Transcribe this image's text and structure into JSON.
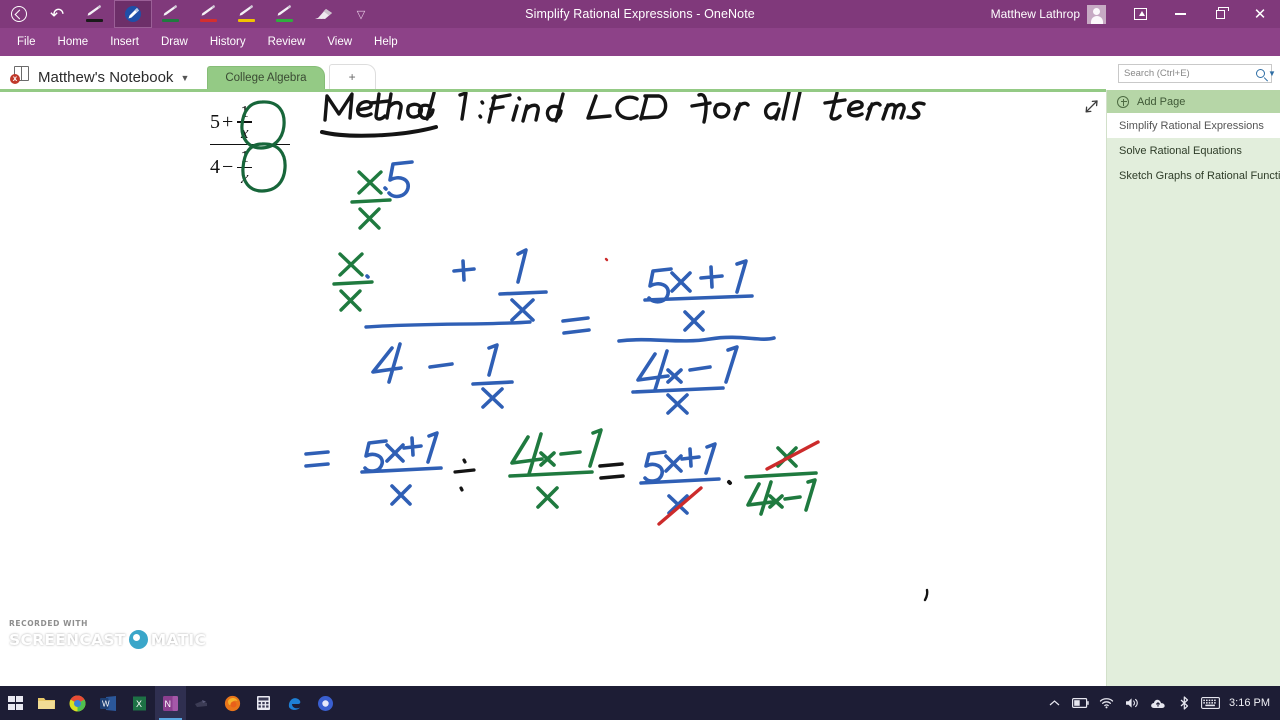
{
  "titlebar": {
    "title": "Simplify Rational Expressions  -  OneNote",
    "user": "Matthew Lathrop",
    "tools": [
      {
        "name": "back-button",
        "icon": "back-circle-icon"
      },
      {
        "name": "undo-button",
        "icon": "undo-icon"
      },
      {
        "name": "pen-black",
        "icon": "pen-icon",
        "color": "#1a1a1a",
        "selected": false
      },
      {
        "name": "pen-blue-selected",
        "icon": "pen-icon",
        "color": "#2f5fb5",
        "selected": true
      },
      {
        "name": "pen-green",
        "icon": "pen-icon",
        "color": "#1f7a3f",
        "selected": false
      },
      {
        "name": "pen-red",
        "icon": "pen-icon",
        "color": "#d32f2f",
        "selected": false
      },
      {
        "name": "pen-yellow",
        "icon": "pen-icon",
        "color": "#f2c200",
        "selected": false
      },
      {
        "name": "pen-brightgreen",
        "icon": "pen-icon",
        "color": "#2fae3e",
        "selected": false
      },
      {
        "name": "eraser",
        "icon": "eraser-icon",
        "color": "#e6dfe6",
        "selected": false
      },
      {
        "name": "more-tools",
        "icon": "chevron-down-icon"
      }
    ],
    "window_buttons": [
      "ribbon-display-icon",
      "minimize-icon",
      "restore-icon",
      "close-icon"
    ]
  },
  "menubar": {
    "items": [
      "File",
      "Home",
      "Insert",
      "Draw",
      "History",
      "Review",
      "View",
      "Help"
    ]
  },
  "notebookbar": {
    "notebook_name": "Matthew's Notebook",
    "sync_error_badge": "x",
    "sections": [
      "College Algebra"
    ],
    "add_section_label": "+"
  },
  "search": {
    "placeholder": "Search (Ctrl+E)",
    "value": ""
  },
  "pagepane": {
    "add_page_label": "Add Page",
    "pages": [
      {
        "title": "Simplify Rational Expressions",
        "active": true
      },
      {
        "title": "Solve Rational Equations",
        "active": false
      },
      {
        "title": "Sketch Graphs of Rational Functio",
        "active": false
      }
    ]
  },
  "canvas": {
    "expand_icon": "expand-arrows-icon",
    "printed_expression": {
      "numerator_lead": "5",
      "numerator_op": "+",
      "denominator_lead": "4",
      "denominator_op": "−",
      "small_numerator": "1",
      "small_denominator": "x",
      "annotation": "green ovals circling both 1/x terms"
    },
    "handwriting": {
      "heading": "Method 1: Find LCD for all terms",
      "heading_color": "#111111",
      "heading_underline_word": "Method",
      "line2_left": "x/x · 5 + 1/x  over  x/x · 4 − 1/x",
      "line2_right": "(5x + 1)/x  over  (4x − 1)/x",
      "line3": "= (5x+1)/x ÷ (4x−1)/x = (5x+1)/x · x/(4x−1)",
      "cancel_marks": "red strikethrough on x in denominator and x in numerator"
    },
    "ink_colors": {
      "black": "#111111",
      "blue": "#2f5fb5",
      "green": "#1f7a3f",
      "dark_green": "#17663a",
      "red": "#cc2b2b"
    }
  },
  "watermark": {
    "recorded_with": "RECORDED WITH",
    "brand_left": "SCREENCAST",
    "brand_right": "MATIC"
  },
  "taskbar": {
    "apps": [
      {
        "name": "start-button",
        "icon": "windows-logo-icon"
      },
      {
        "name": "file-explorer",
        "icon": "folder-icon"
      },
      {
        "name": "chrome",
        "icon": "chrome-icon"
      },
      {
        "name": "word",
        "icon": "word-icon"
      },
      {
        "name": "excel",
        "icon": "excel-icon"
      },
      {
        "name": "onenote",
        "icon": "onenote-icon",
        "active": true
      },
      {
        "name": "unknown-app",
        "icon": "dark-app-icon"
      },
      {
        "name": "firefox",
        "icon": "firefox-icon"
      },
      {
        "name": "calculator",
        "icon": "calculator-icon"
      },
      {
        "name": "edge",
        "icon": "edge-icon"
      },
      {
        "name": "media-app",
        "icon": "blue-circle-icon"
      }
    ],
    "tray": [
      {
        "name": "show-hidden-icons",
        "icon": "chevron-up-icon"
      },
      {
        "name": "battery",
        "icon": "battery-icon"
      },
      {
        "name": "network",
        "icon": "wifi-icon"
      },
      {
        "name": "volume",
        "icon": "speaker-icon"
      },
      {
        "name": "onedrive",
        "icon": "cloud-icon"
      },
      {
        "name": "bluetooth",
        "icon": "bluetooth-icon"
      },
      {
        "name": "touch-keyboard",
        "icon": "keyboard-icon"
      }
    ],
    "clock": "3:16 PM"
  }
}
